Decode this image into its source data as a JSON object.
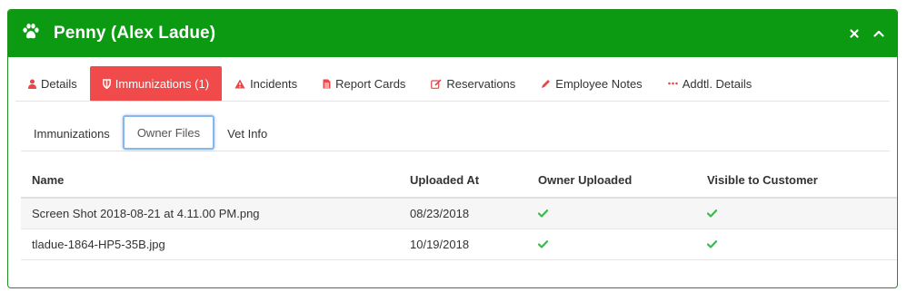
{
  "header": {
    "title": "Penny (Alex Ladue)",
    "close_glyph": "×",
    "collapse_glyph": "^",
    "background": "#0b9a12"
  },
  "main_tabs": [
    {
      "label": "Details",
      "icon": "user-icon",
      "active": false
    },
    {
      "label": "Immunizations (1)",
      "icon": "shield-icon",
      "active": true
    },
    {
      "label": "Incidents",
      "icon": "warning-icon",
      "active": false
    },
    {
      "label": "Report Cards",
      "icon": "document-icon",
      "active": false
    },
    {
      "label": "Reservations",
      "icon": "edit-icon",
      "active": false
    },
    {
      "label": "Employee Notes",
      "icon": "pencil-icon",
      "active": false
    },
    {
      "label": "Addtl. Details",
      "icon": "ellipsis-icon",
      "active": false
    }
  ],
  "sub_tabs": [
    {
      "label": "Immunizations",
      "active": false
    },
    {
      "label": "Owner Files",
      "active": true
    },
    {
      "label": "Vet Info",
      "active": false
    }
  ],
  "table": {
    "columns": [
      "Name",
      "Uploaded At",
      "Owner Uploaded",
      "Visible to Customer"
    ],
    "rows": [
      {
        "name": "Screen Shot 2018-08-21 at 4.11.00 PM.png",
        "uploaded_at": "08/23/2018",
        "owner_uploaded": true,
        "visible_to_customer": true
      },
      {
        "name": "tladue-1864-HP5-35B.jpg",
        "uploaded_at": "10/19/2018",
        "owner_uploaded": true,
        "visible_to_customer": true
      }
    ]
  },
  "colors": {
    "active_tab": "#f04a4a",
    "check": "#3cb84f",
    "focus_ring": "#86b7e8"
  }
}
